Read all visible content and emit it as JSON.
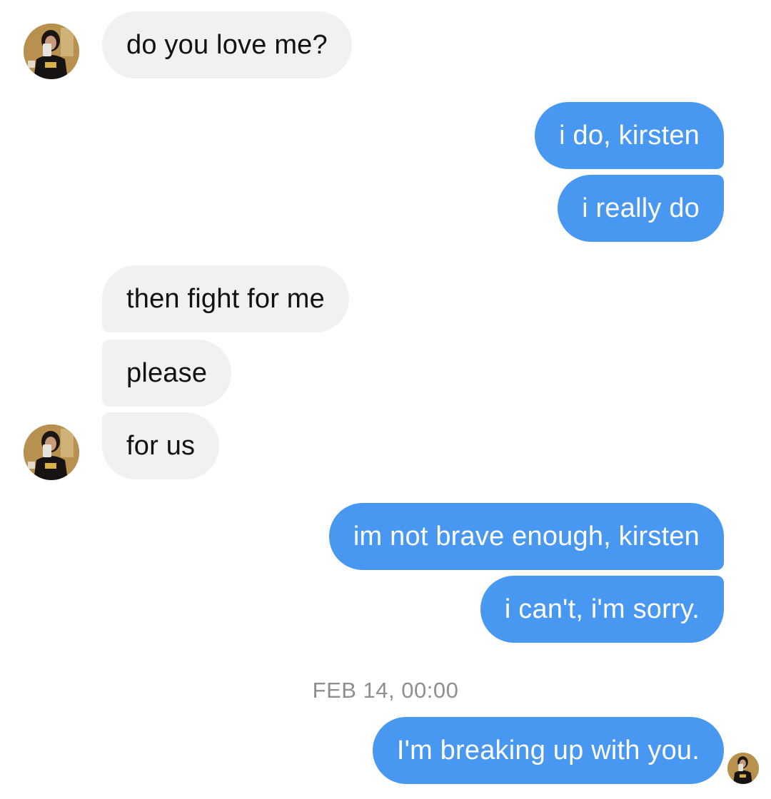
{
  "conversation": {
    "messages": [
      {
        "sender": "them",
        "text": "do you love me?"
      },
      {
        "sender": "me",
        "text": "i do, kirsten"
      },
      {
        "sender": "me",
        "text": "i really do"
      },
      {
        "sender": "them",
        "text": "then fight for me"
      },
      {
        "sender": "them",
        "text": "please"
      },
      {
        "sender": "them",
        "text": "for us"
      },
      {
        "sender": "me",
        "text": "im not brave enough, kirsten"
      },
      {
        "sender": "me",
        "text": "i can't, i'm sorry."
      },
      {
        "sender": "me",
        "text": "I'm breaking up with you."
      }
    ],
    "timestamp": "FEB 14, 00:00"
  },
  "colors": {
    "incoming_bubble": "#f1f1f4",
    "outgoing_bubble": "#4897f1",
    "incoming_text": "#111111",
    "outgoing_text": "#ffffff",
    "timestamp_text": "#8e8e93"
  },
  "icons": {
    "contact_avatar": "contact-avatar-icon",
    "read_receipt_avatar": "read-receipt-avatar-icon"
  }
}
